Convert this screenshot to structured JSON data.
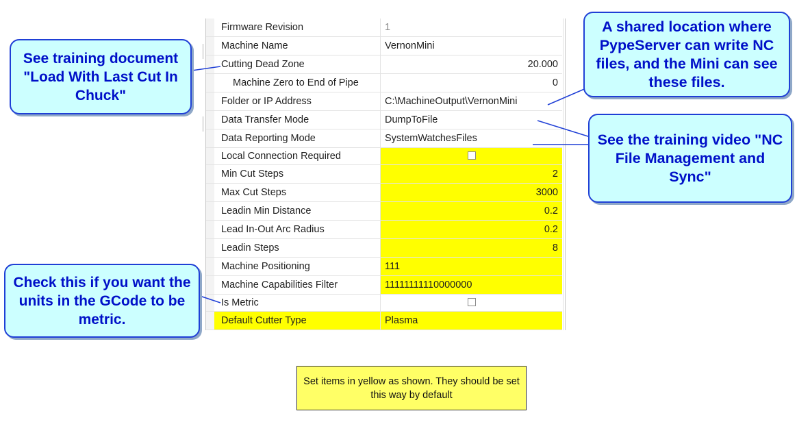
{
  "grid": {
    "rows": [
      {
        "name": "Firmware Revision",
        "value": "1"
      },
      {
        "name": "Machine Name",
        "value": "VernonMini"
      },
      {
        "name": "Cutting Dead Zone",
        "value": "20.000"
      },
      {
        "name": "Machine Zero to End of Pipe",
        "value": "0"
      },
      {
        "name": "Folder or IP Address",
        "value": "C:\\MachineOutput\\VernonMini"
      },
      {
        "name": "Data Transfer Mode",
        "value": "DumpToFile"
      },
      {
        "name": "Data Reporting Mode",
        "value": "SystemWatchesFiles"
      },
      {
        "name": "Local Connection Required",
        "value": ""
      },
      {
        "name": "Min Cut Steps",
        "value": "2"
      },
      {
        "name": "Max Cut Steps",
        "value": "3000"
      },
      {
        "name": "Leadin Min Distance",
        "value": "0.2"
      },
      {
        "name": "Lead In-Out Arc Radius",
        "value": "0.2"
      },
      {
        "name": "Leadin Steps",
        "value": "8"
      },
      {
        "name": "Machine Positioning",
        "value": "111"
      },
      {
        "name": "Machine Capabilities Filter",
        "value": "11111111110000000"
      },
      {
        "name": "Is Metric",
        "value": ""
      },
      {
        "name": "Default Cutter Type",
        "value": "Plasma"
      }
    ]
  },
  "callouts": {
    "load_with_last_cut": "See training document \"Load With Last Cut In Chuck\"",
    "shared_location": "A shared location where PypeServer can write NC files, and the Mini can see these files.",
    "nc_file_management": "See the training video \"NC File Management and Sync\"",
    "is_metric_hint": "Check this if you want the units in the GCode to be metric."
  },
  "note": {
    "text": "Set items in yellow as shown. They should be set this way by default"
  },
  "colors": {
    "highlight": "#ffff00",
    "callout_fill": "#ccffff",
    "callout_text": "#0010c8",
    "note_fill": "#ffff66"
  }
}
